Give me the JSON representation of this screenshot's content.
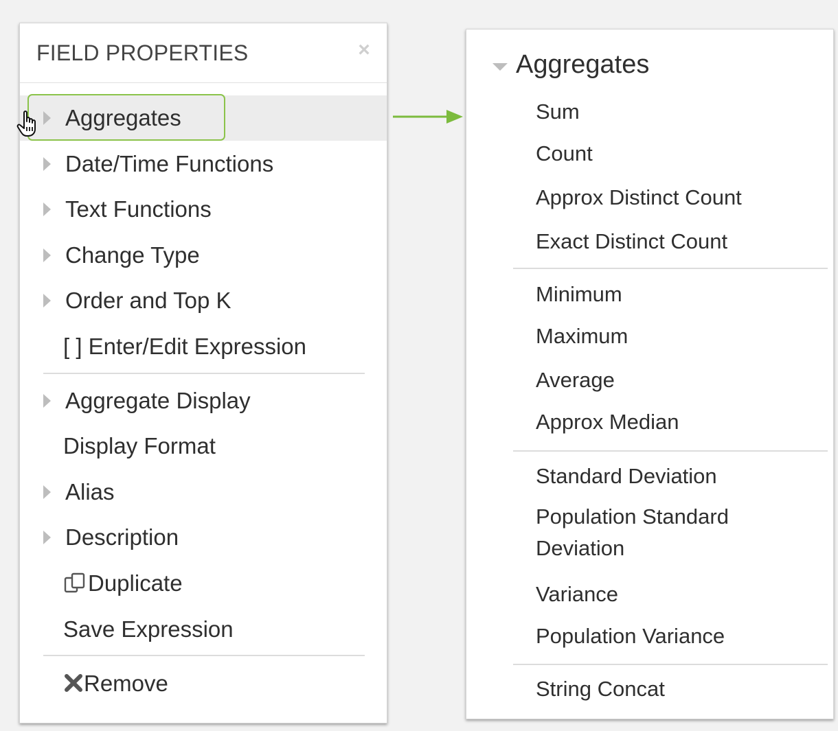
{
  "field_properties": {
    "title": "FIELD PROPERTIES",
    "close_icon": "×",
    "items": [
      {
        "label": "Aggregates",
        "has_arrow": true,
        "selected": true
      },
      {
        "label": "Date/Time Functions",
        "has_arrow": true
      },
      {
        "label": "Text Functions",
        "has_arrow": true
      },
      {
        "label": "Change Type",
        "has_arrow": true
      },
      {
        "label": "Order and Top K",
        "has_arrow": true
      },
      {
        "label": "[ ] Enter/Edit Expression",
        "has_arrow": false
      },
      {
        "label": "Aggregate Display",
        "has_arrow": true
      },
      {
        "label": "Display Format",
        "has_arrow": false
      },
      {
        "label": "Alias",
        "has_arrow": true
      },
      {
        "label": "Description",
        "has_arrow": true
      },
      {
        "label": "Duplicate",
        "has_arrow": false,
        "icon": "duplicate-icon"
      },
      {
        "label": "Save Expression",
        "has_arrow": false
      },
      {
        "label": "Remove",
        "has_arrow": false,
        "icon": "remove-x-icon"
      }
    ],
    "highlight_color": "#8bc34a"
  },
  "aggregates_menu": {
    "title": "Aggregates",
    "groups": [
      [
        "Sum",
        "Count",
        "Approx Distinct Count",
        "Exact Distinct Count"
      ],
      [
        "Minimum",
        "Maximum",
        "Average",
        "Approx Median"
      ],
      [
        "Standard Deviation",
        "Population Standard Deviation",
        "Variance",
        "Population Variance"
      ],
      [
        "String Concat"
      ]
    ]
  },
  "connector_color": "#7cbb3e"
}
